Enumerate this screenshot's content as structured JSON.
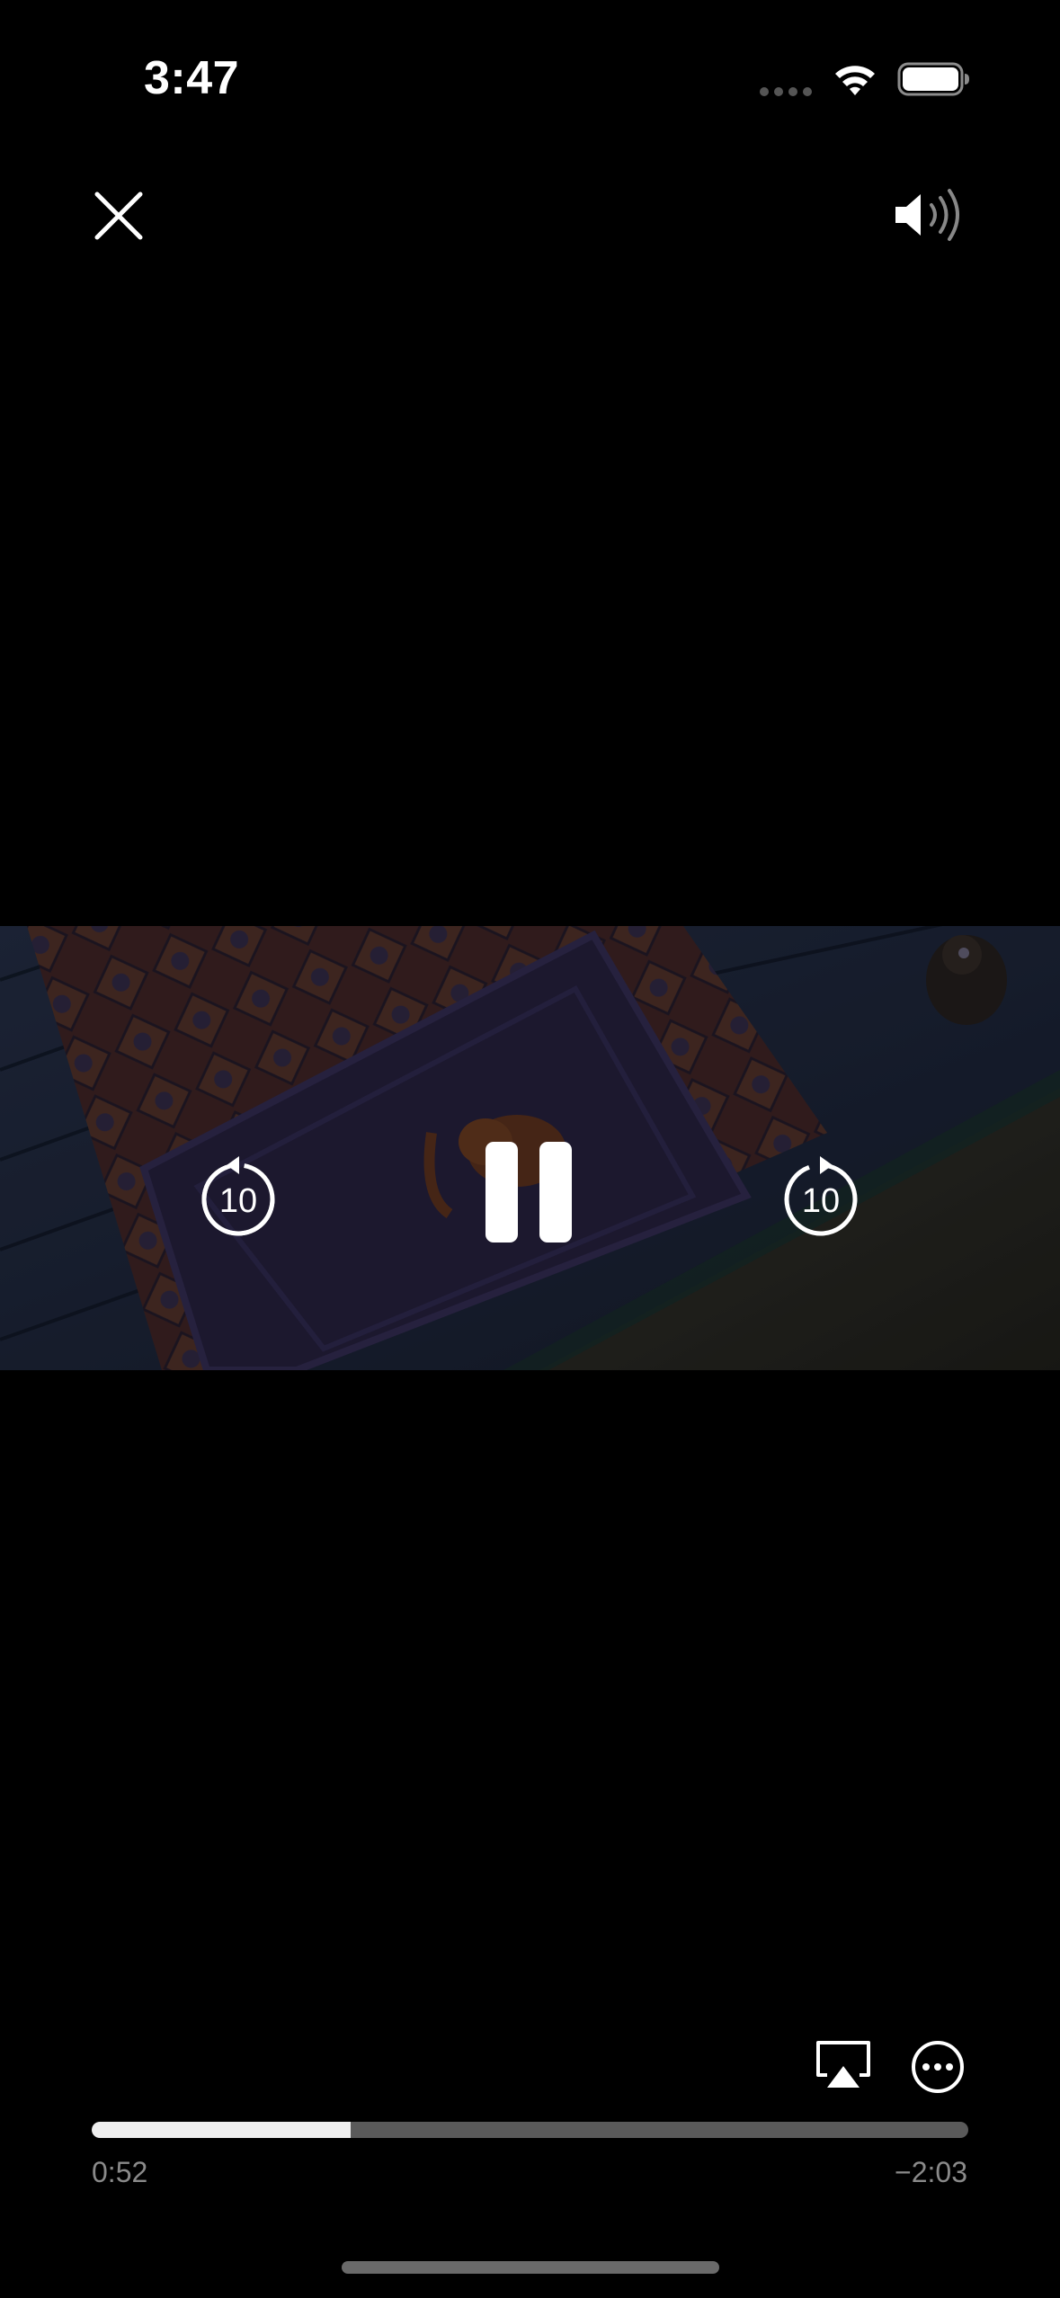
{
  "status_bar": {
    "time": "3:47",
    "icons": [
      "cellular-signal-icon",
      "wifi-icon",
      "battery-icon"
    ]
  },
  "top_controls": {
    "close_icon": "close-icon",
    "volume_icon": "speaker-volume-icon"
  },
  "video": {
    "state": "paused-overlay-visible",
    "skip_back_seconds": "10",
    "skip_forward_seconds": "10",
    "center_control_icon": "pause-icon"
  },
  "bottom_controls": {
    "airplay_icon": "airplay-icon",
    "more_icon": "more-options-icon"
  },
  "playback": {
    "elapsed": "0:52",
    "remaining": "−2:03",
    "progress_fraction": 0.295
  },
  "colors": {
    "background": "#000000",
    "progress_fill": "#efefef",
    "progress_track": "#5a5a5a",
    "time_text": "#8a8a8a"
  }
}
